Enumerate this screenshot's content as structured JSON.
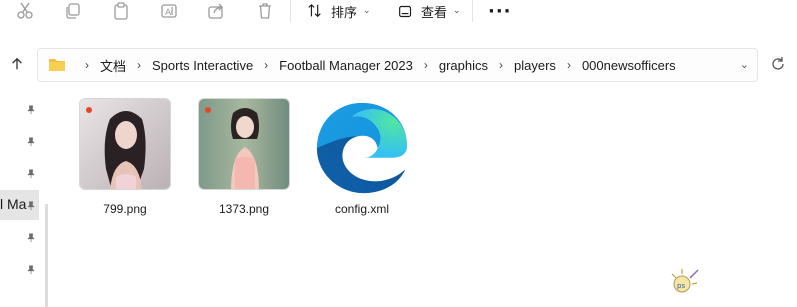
{
  "toolbar": {
    "icons": [
      "cut-icon",
      "copy-icon",
      "paste-icon",
      "rename-icon",
      "share-icon",
      "delete-icon"
    ],
    "sort_label": "排序",
    "view_label": "查看",
    "more_label": "···"
  },
  "address_bar": {
    "crumbs": [
      "文档",
      "Sports Interactive",
      "Football Manager 2023",
      "graphics",
      "players",
      "000newsofficers"
    ]
  },
  "nav_pane": {
    "selected_label": "l Ma"
  },
  "files": [
    {
      "name": "799.png",
      "type": "image"
    },
    {
      "name": "1373.png",
      "type": "image"
    },
    {
      "name": "config.xml",
      "type": "edge-document"
    }
  ],
  "colors": {
    "edge_blue": "#1b6fd4",
    "edge_green": "#3ed28a",
    "pin": "#6b6b6b",
    "folder": "#f3c142"
  }
}
